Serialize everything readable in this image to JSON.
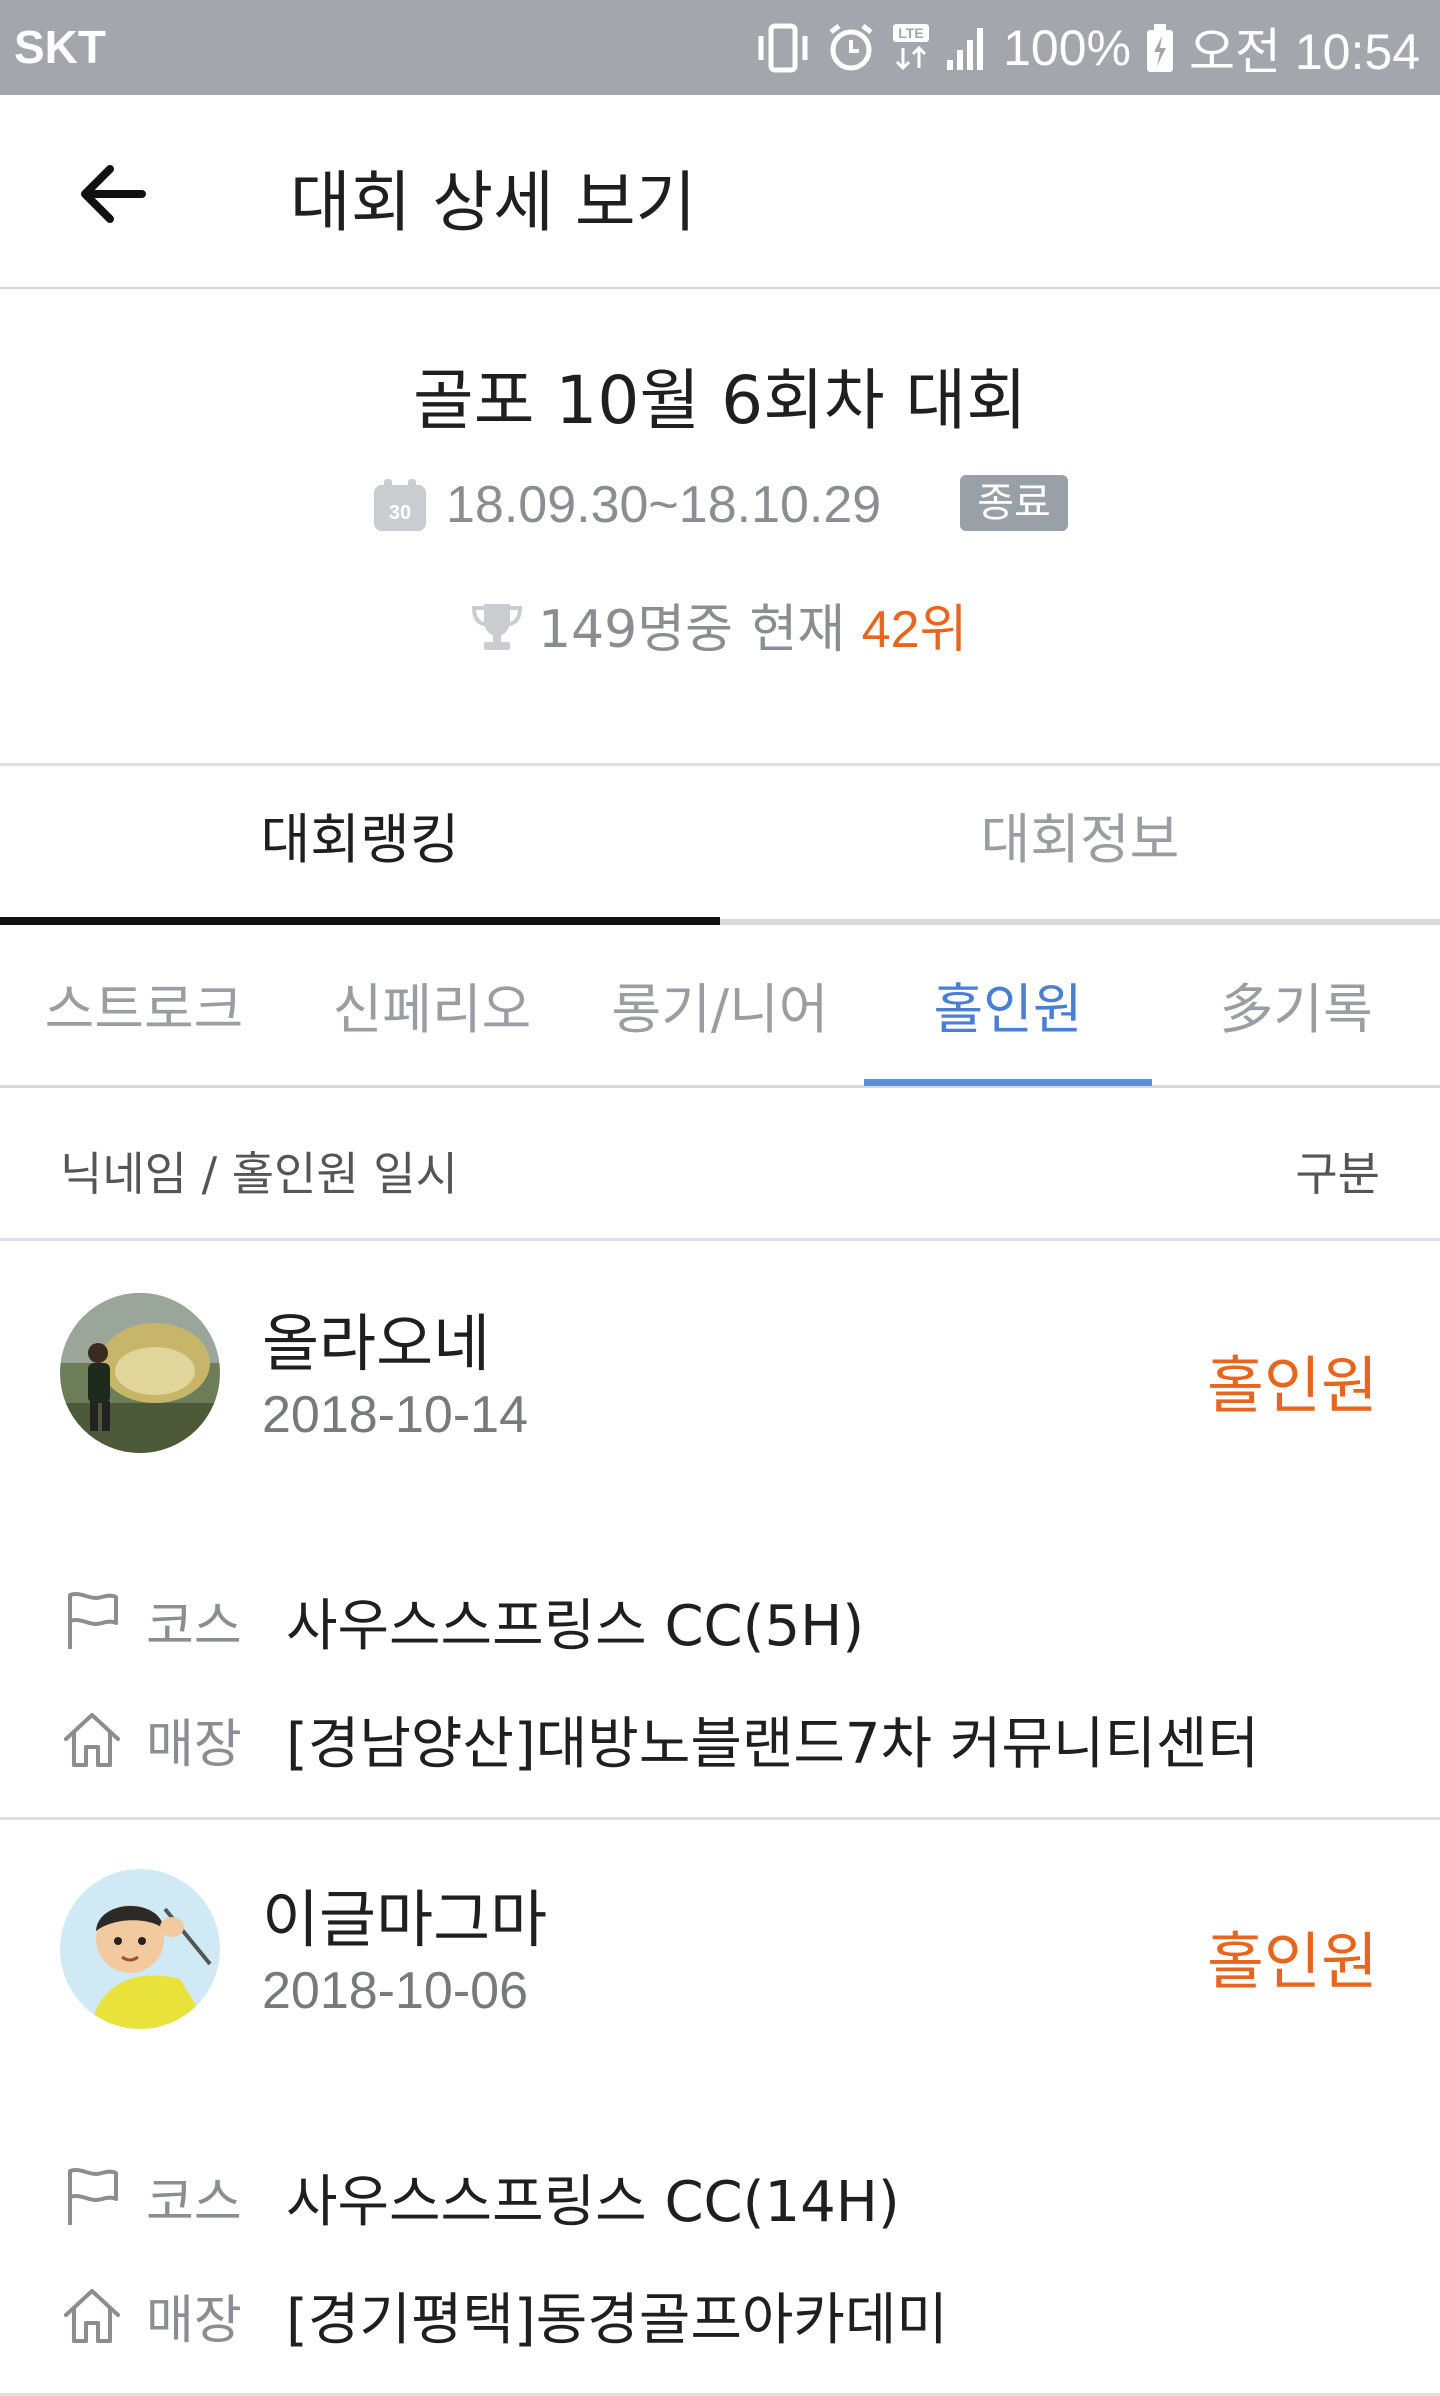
{
  "status_bar": {
    "carrier": "SKT",
    "battery": "100%",
    "time": "오전 10:54",
    "network": "LTE"
  },
  "app_bar": {
    "title": "대회 상세 보기",
    "back_icon": "arrow-left-icon"
  },
  "event": {
    "title": "골포 10월 6회차 대회",
    "calendar_icon_day": "30",
    "dates": "18.09.30~18.10.29",
    "status_badge": "종료",
    "rank_prefix": "149명중 현재 ",
    "rank_value": "42위"
  },
  "tabs": [
    {
      "label": "대회랭킹",
      "active": true
    },
    {
      "label": "대회정보",
      "active": false
    }
  ],
  "subtabs": [
    {
      "label": "스트로크",
      "active": false
    },
    {
      "label": "신페리오",
      "active": false
    },
    {
      "label": "롱기/니어",
      "active": false
    },
    {
      "label": "홀인원",
      "active": true
    },
    {
      "label": "多기록",
      "active": false
    }
  ],
  "list_header": {
    "left": "닉네임 / 홀인원 일시",
    "right": "구분"
  },
  "entries": [
    {
      "nickname": "올라오네",
      "date": "2018-10-14",
      "kind": "홀인원",
      "course_label": "코스",
      "course": "사우스스프링스 CC(5H)",
      "store_label": "매장",
      "store": "[경남양산]대방노블랜드7차 커뮤니티센터"
    },
    {
      "nickname": "이글마그마",
      "date": "2018-10-06",
      "kind": "홀인원",
      "course_label": "코스",
      "course": "사우스스프링스 CC(14H)",
      "store_label": "매장",
      "store": "[경기평택]동경골프아카데미"
    }
  ],
  "colors": {
    "accent_orange": "#e8651d",
    "accent_blue": "#4a7fd6",
    "status_bar": "#a3a6ad"
  }
}
